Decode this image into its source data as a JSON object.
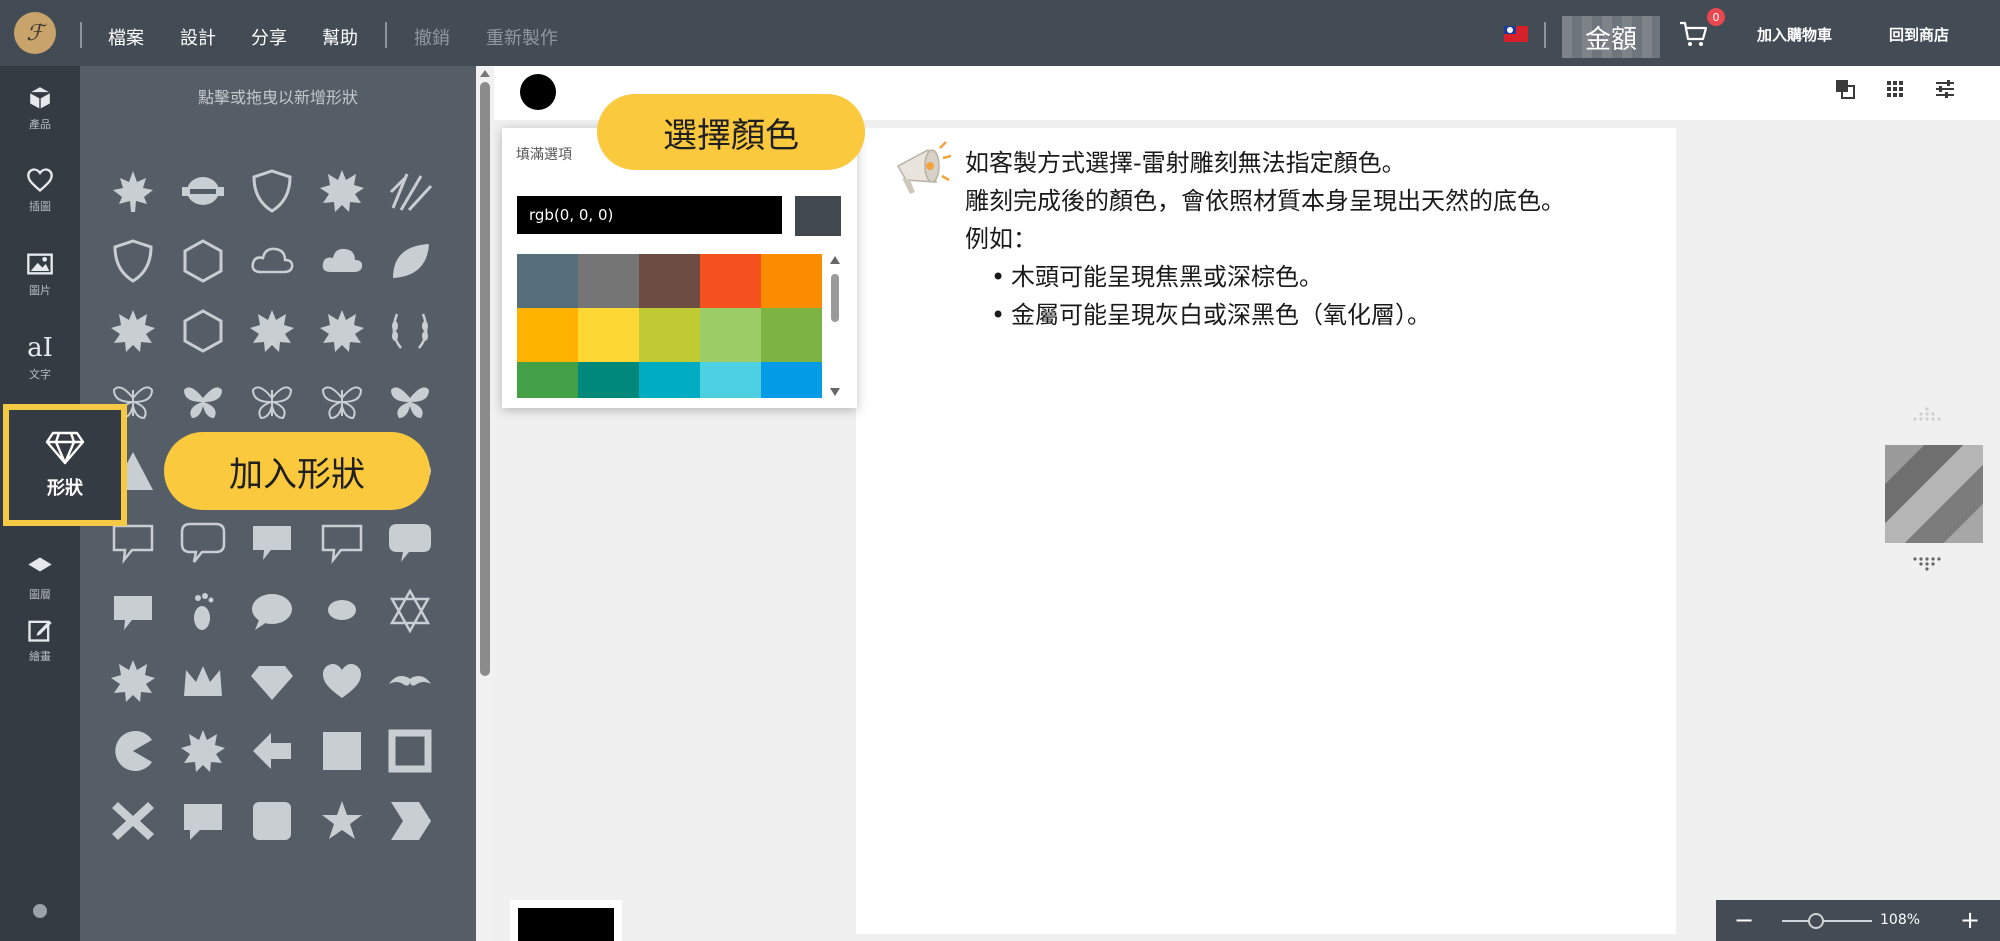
{
  "topbar": {
    "menu": [
      "檔案",
      "設計",
      "分享",
      "幫助"
    ],
    "undo": "撤銷",
    "redo": "重新製作",
    "amount": "金額",
    "cart_count": "0",
    "add_to_cart": "加入購物車",
    "back_to_store": "回到商店"
  },
  "rail": {
    "items": [
      {
        "label": "產品",
        "icon": "cube-icon"
      },
      {
        "label": "插圖",
        "icon": "heart-icon"
      },
      {
        "label": "圖片",
        "icon": "image-icon"
      },
      {
        "label": "文字",
        "icon": "text-icon"
      },
      {
        "label": "形狀",
        "icon": "diamond-icon"
      },
      {
        "label": "圖層",
        "icon": "layers-icon"
      },
      {
        "label": "繪畫",
        "icon": "edit-icon"
      }
    ]
  },
  "panel": {
    "hint": "點擊或拖曳以新增形狀",
    "shapes": [
      "maple-leaf-icon",
      "badge-ribbon-icon",
      "shield-icon",
      "sun-icon",
      "burst-lines-icon",
      "horse-shield-icon",
      "hexagon-ring-icon",
      "cloud-outline-icon",
      "cloud-icon",
      "leaf-icon",
      "sun-gear-icon",
      "hexagon-shutter-icon",
      "starburst-icon",
      "gear-icon",
      "laurel-icon",
      "butterfly-outline-icon",
      "butterfly-side-icon",
      "butterfly-icon",
      "butterfly-ornate-icon",
      "butterfly-wing-icon",
      "triangle-icon",
      "triangle-small-icon",
      "line-icon",
      "thick-line-icon",
      "ellipse-icon",
      "speech-bubble-outline-icon",
      "speech-bubble-round-icon",
      "speech-bubble-icon",
      "speech-rect-outline-icon",
      "speech-filled-icon",
      "speech-square-icon",
      "footprint-icon",
      "chat-oval-icon",
      "chat-small-icon",
      "star-of-david-icon",
      "seal-icon",
      "crown-icon",
      "diamond-gem-icon",
      "hearts-icon",
      "mustache-icon",
      "pacman-icon",
      "badge-star-icon",
      "arrow-left-icon",
      "square-icon",
      "square-frame-icon",
      "cross-icon",
      "callout-icon",
      "rounded-square-icon",
      "star-icon",
      "chevron-icon"
    ]
  },
  "callouts": {
    "add_shape": "加入形狀",
    "choose_color": "選擇顏色"
  },
  "color_popup": {
    "title": "填滿選項",
    "value": "rgb(0, 0, 0)",
    "palette": [
      "#546e7a",
      "#757575",
      "#6d4c41",
      "#f4511e",
      "#fb8c00",
      "#ffb300",
      "#fdd835",
      "#c0ca33",
      "#9ccc65",
      "#7cb342",
      "#43a047",
      "#00897b",
      "#00acc1",
      "#4dd0e1",
      "#039be5"
    ]
  },
  "notice": {
    "lines": [
      "如客製方式選擇-雷射雕刻無法指定顏色。",
      "雕刻完成後的顏色，會依照材質本身呈現出天然的底色。",
      "例如："
    ],
    "bullets": [
      "木頭可能呈現焦黑或深棕色。",
      "金屬可能呈現灰白或深黑色（氧化層）。"
    ]
  },
  "zoom": {
    "level": "108%",
    "value_percent": 108
  }
}
